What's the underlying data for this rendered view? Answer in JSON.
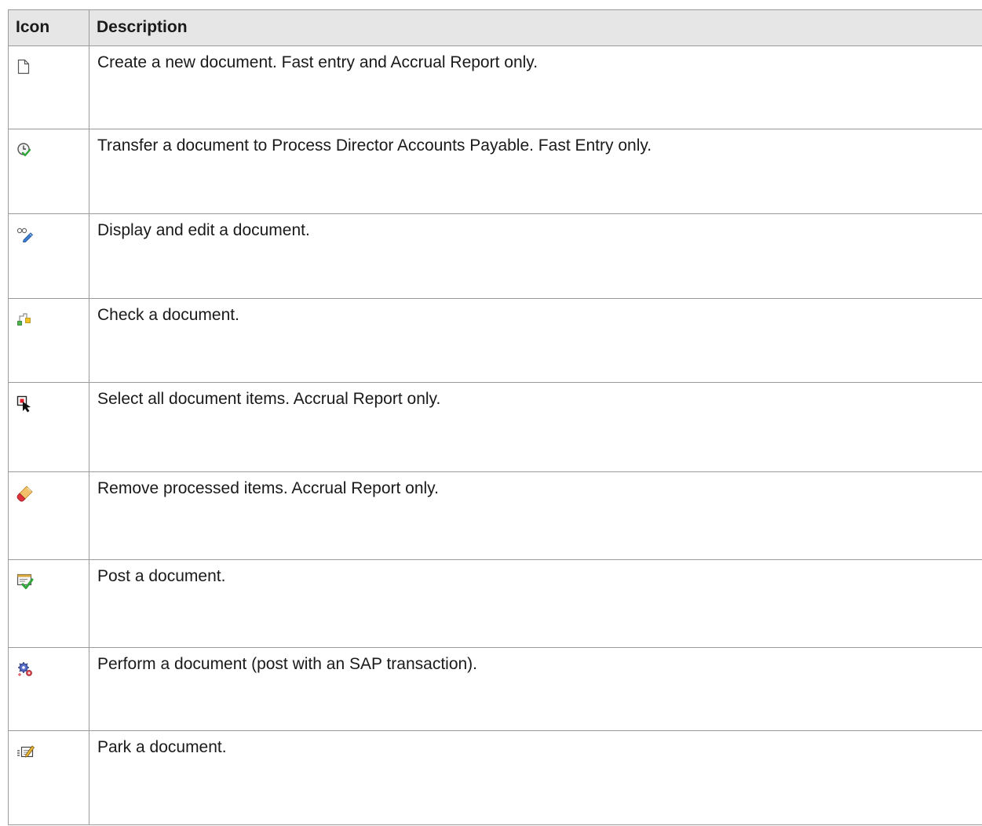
{
  "table": {
    "headers": {
      "icon": "Icon",
      "description": "Description"
    },
    "rows": [
      {
        "icon": "new-document-icon",
        "description": "Create a new document. Fast entry and Accrual Report only."
      },
      {
        "icon": "transfer-document-icon",
        "description": "Transfer a document to Process Director Accounts Payable. Fast Entry only."
      },
      {
        "icon": "display-edit-icon",
        "description": "Display and edit a document."
      },
      {
        "icon": "check-document-icon",
        "description": "Check a document."
      },
      {
        "icon": "select-all-icon",
        "description": "Select all document items. Accrual Report only."
      },
      {
        "icon": "eraser-icon",
        "description": "Remove processed items. Accrual Report only."
      },
      {
        "icon": "post-document-icon",
        "description": "Post a document."
      },
      {
        "icon": "perform-document-icon",
        "description": "Perform a document (post with an SAP transaction)."
      },
      {
        "icon": "park-document-icon",
        "description": "Park a document."
      }
    ]
  }
}
